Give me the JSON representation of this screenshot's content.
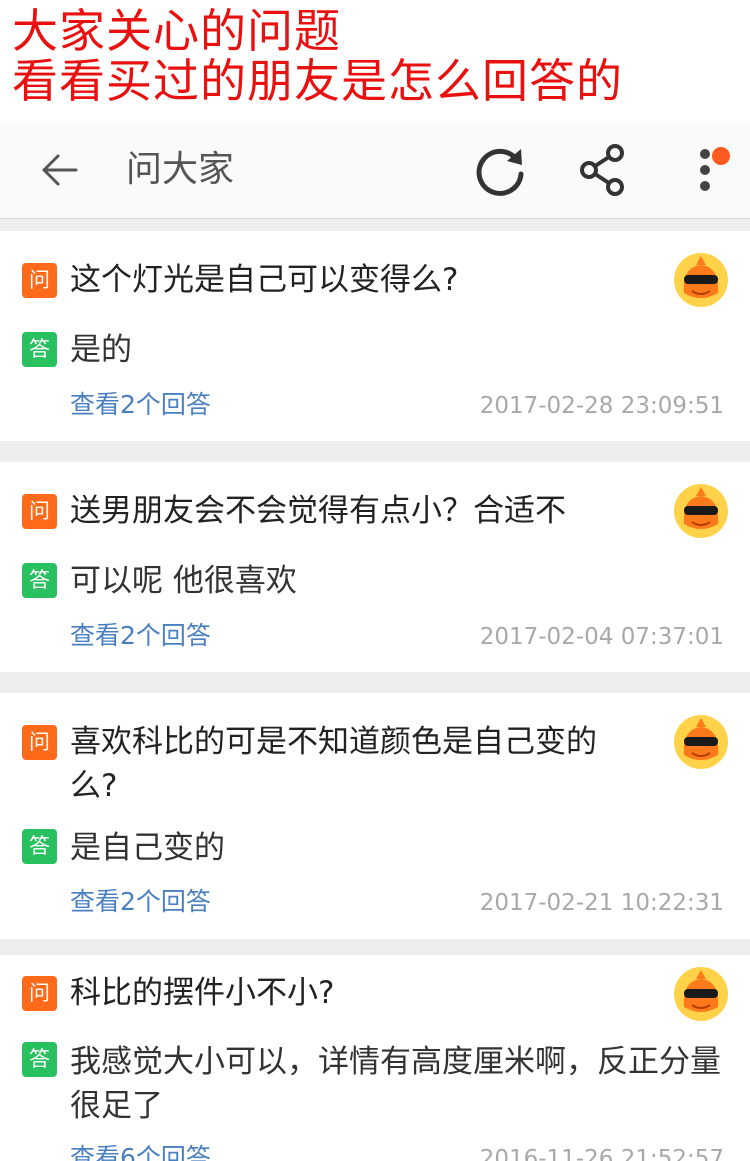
{
  "banner": {
    "line1": "大家关心的问题",
    "line2": "看看买过的朋友是怎么回答的"
  },
  "toolbar": {
    "title": "问大家",
    "back_icon": "arrow-left-icon",
    "refresh_icon": "refresh-icon",
    "share_icon": "share-icon",
    "more_icon": "more-vertical-icon",
    "notification_dot_color": "#ff5a1f"
  },
  "labels": {
    "question_badge": "问",
    "answer_badge": "答"
  },
  "colors": {
    "banner_text": "#e8110f",
    "question_badge": "#ff6a1a",
    "answer_badge": "#29c160",
    "link": "#4a7fc1",
    "date": "#a8a8a8"
  },
  "questions": [
    {
      "question": "这个灯光是自己可以变得么?",
      "answer": "是的",
      "more": "查看2个回答",
      "date": "2017-02-28 23:09:51"
    },
    {
      "question": "送男朋友会不会觉得有点小？合适不",
      "answer": "可以呢 他很喜欢",
      "more": "查看2个回答",
      "date": "2017-02-04 07:37:01"
    },
    {
      "question": "喜欢科比的可是不知道颜色是自己变的么?",
      "answer": "是自己变的",
      "more": "查看2个回答",
      "date": "2017-02-21 10:22:31"
    },
    {
      "question": "科比的摆件小不小?",
      "answer": "我感觉大小可以，详情有高度厘米啊，反正分量很足了",
      "more": "查看6个回答",
      "date": "2016-11-26 21:52:57"
    }
  ]
}
